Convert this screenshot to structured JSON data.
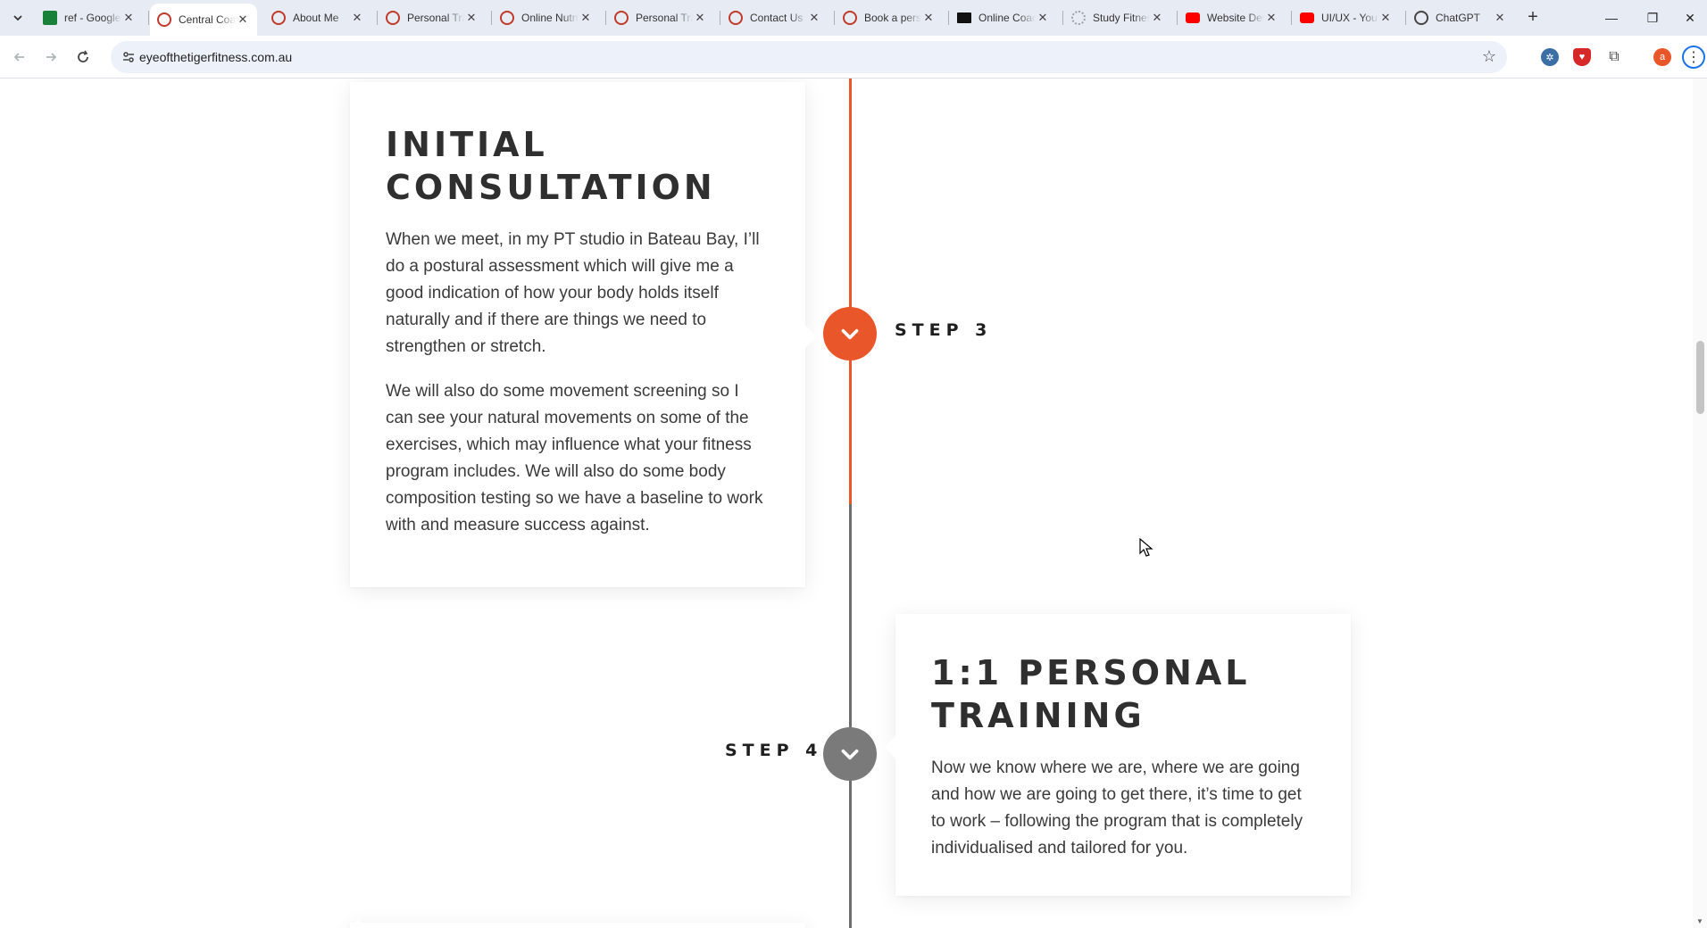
{
  "browser": {
    "tabs": [
      {
        "title": "ref - Google Sheets",
        "favicon_color": "#188038",
        "active": false
      },
      {
        "title": "Central Coast",
        "favicon_color": "#c0392b",
        "active": true
      },
      {
        "title": "About Me",
        "favicon_color": "#c0392b",
        "active": false
      },
      {
        "title": "Personal Training",
        "favicon_color": "#c0392b",
        "active": false
      },
      {
        "title": "Online Nutrition",
        "favicon_color": "#c0392b",
        "active": false
      },
      {
        "title": "Personal Training",
        "favicon_color": "#c0392b",
        "active": false
      },
      {
        "title": "Contact Us",
        "favicon_color": "#c0392b",
        "active": false
      },
      {
        "title": "Book a personal",
        "favicon_color": "#c0392b",
        "active": false
      },
      {
        "title": "Online Coaching",
        "favicon_color": "#111111",
        "active": false
      },
      {
        "title": "Study Fitness",
        "favicon_color": "#9aa0a6",
        "active": false
      },
      {
        "title": "Website Design",
        "favicon_color": "#ff0000",
        "active": false
      },
      {
        "title": "UI/UX - YouTube",
        "favicon_color": "#ff0000",
        "active": false
      },
      {
        "title": "ChatGPT",
        "favicon_color": "#444444",
        "active": false
      }
    ],
    "url": "eyeofthetigerfitness.com.au",
    "profile_initial": "a"
  },
  "timeline": {
    "accent_color": "#e8562a",
    "muted_color": "#7a7a7a",
    "steps": [
      {
        "label": "STEP 3",
        "title": "INITIAL CONSULTATION",
        "paragraphs": [
          "When we meet, in my PT studio in Bateau Bay, I’ll do a postural assessment which will give me a good indication of how your body holds itself naturally and if there are things we need to strengthen or stretch.",
          "We will also do some movement screening so I can see your natural movements on some of the exercises, which may influence what your fitness program includes. We will also do some body composition testing so we have a baseline to work with and measure success against."
        ],
        "status": "active"
      },
      {
        "label": "STEP 4",
        "title": "1:1 PERSONAL TRAINING",
        "paragraphs": [
          "Now we know where we are, where we are going and how we are going to get there, it’s time to get to work – following the program that is completely individualised and tailored for you."
        ],
        "status": "inactive"
      }
    ]
  }
}
